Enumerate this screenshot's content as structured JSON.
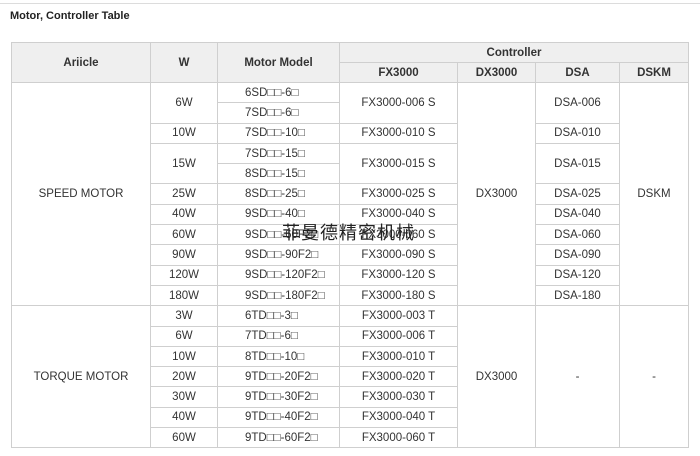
{
  "title": "Motor, Controller Table",
  "watermark": "菲曼德精密机械",
  "headers": {
    "article": "Ariicle",
    "w": "W",
    "model": "Motor Model",
    "controller": "Controller",
    "fx3000": "FX3000",
    "dx3000": "DX3000",
    "dsa": "DSA",
    "dskm": "DSKM"
  },
  "groups": {
    "speed": "SPEED MOTOR",
    "torque": "TORQUE MOTOR"
  },
  "speed": {
    "w": [
      "6W",
      "10W",
      "15W",
      "25W",
      "40W",
      "60W",
      "90W",
      "120W",
      "180W"
    ],
    "models": [
      "6SD□□-6□",
      "7SD□□-6□",
      "7SD□□-10□",
      "7SD□□-15□",
      "8SD□□-15□",
      "8SD□□-25□",
      "9SD□□-40□",
      "9SD□□-60F2□",
      "9SD□□-90F2□",
      "9SD□□-120F2□",
      "9SD□□-180F2□"
    ],
    "fx": [
      "FX3000-006 S",
      "FX3000-010 S",
      "FX3000-015 S",
      "FX3000-025 S",
      "FX3000-040 S",
      "FX3000-060 S",
      "FX3000-090 S",
      "FX3000-120 S",
      "FX3000-180 S"
    ],
    "dx": "DX3000",
    "dsa": [
      "DSA-006",
      "DSA-010",
      "DSA-015",
      "DSA-025",
      "DSA-040",
      "DSA-060",
      "DSA-090",
      "DSA-120",
      "DSA-180"
    ],
    "dskm": "DSKM"
  },
  "torque": {
    "w": [
      "3W",
      "6W",
      "10W",
      "20W",
      "30W",
      "40W",
      "60W"
    ],
    "models": [
      "6TD□□-3□",
      "7TD□□-6□",
      "8TD□□-10□",
      "9TD□□-20F2□",
      "9TD□□-30F2□",
      "9TD□□-40F2□",
      "9TD□□-60F2□"
    ],
    "fx": [
      "FX3000-003 T",
      "FX3000-006 T",
      "FX3000-010 T",
      "FX3000-020 T",
      "FX3000-030 T",
      "FX3000-040 T",
      "FX3000-060 T"
    ],
    "dx": "DX3000",
    "dsa": "-",
    "dskm": "-"
  }
}
